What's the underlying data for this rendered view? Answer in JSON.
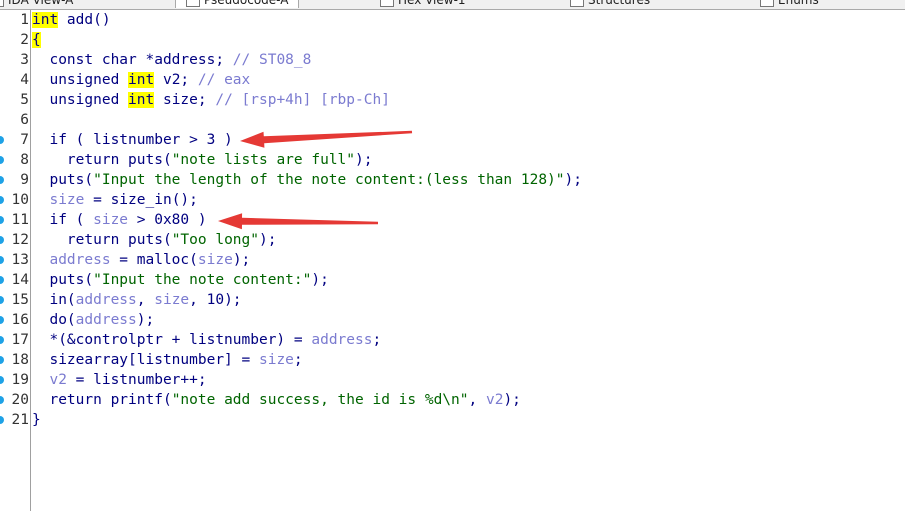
{
  "tabs": [
    {
      "label": "IDA View-A",
      "icon": "ida-view-icon"
    },
    {
      "label": "Pseudocode-A",
      "icon": "pseudocode-icon",
      "active": true
    },
    {
      "label": "Hex View-1",
      "icon": "hex-view-icon"
    },
    {
      "label": "Structures",
      "icon": "structures-icon"
    },
    {
      "label": "Enums",
      "icon": "enums-icon"
    }
  ],
  "colors": {
    "keyword": "#000080",
    "variable": "#7b7bd0",
    "string": "#006400",
    "highlight": "#ffff00",
    "breakpoint": "#1fa2e6",
    "arrow": "#e53935"
  },
  "lines": [
    {
      "n": "1",
      "bp": false,
      "tokens": [
        [
          "hl",
          "int"
        ],
        [
          "kw",
          " add()"
        ]
      ]
    },
    {
      "n": "2",
      "bp": false,
      "tokens": [
        [
          "hl",
          "{"
        ]
      ]
    },
    {
      "n": "3",
      "bp": false,
      "tokens": [
        [
          "kw",
          "  const char *address; "
        ],
        [
          "cmt",
          "// ST08_8"
        ]
      ]
    },
    {
      "n": "4",
      "bp": false,
      "tokens": [
        [
          "kw",
          "  unsigned "
        ],
        [
          "hl",
          "int"
        ],
        [
          "kw",
          " v2; "
        ],
        [
          "cmt",
          "// eax"
        ]
      ]
    },
    {
      "n": "5",
      "bp": false,
      "tokens": [
        [
          "kw",
          "  unsigned "
        ],
        [
          "hl",
          "int"
        ],
        [
          "kw",
          " size; "
        ],
        [
          "cmt",
          "// [rsp+4h] [rbp-Ch]"
        ]
      ]
    },
    {
      "n": "6",
      "bp": false,
      "tokens": []
    },
    {
      "n": "7",
      "bp": true,
      "tokens": [
        [
          "kw",
          "  if ( listnumber > 3 )"
        ]
      ]
    },
    {
      "n": "8",
      "bp": true,
      "tokens": [
        [
          "kw",
          "    return puts("
        ],
        [
          "str",
          "\"note lists are full\""
        ],
        [
          "kw",
          ");"
        ]
      ]
    },
    {
      "n": "9",
      "bp": true,
      "tokens": [
        [
          "kw",
          "  puts("
        ],
        [
          "str",
          "\"Input the length of the note content:(less than 128)\""
        ],
        [
          "kw",
          ");"
        ]
      ]
    },
    {
      "n": "10",
      "bp": true,
      "tokens": [
        [
          "var",
          "  size"
        ],
        [
          "kw",
          " = size_in();"
        ]
      ]
    },
    {
      "n": "11",
      "bp": true,
      "tokens": [
        [
          "kw",
          "  if ( "
        ],
        [
          "var",
          "size"
        ],
        [
          "kw",
          " > 0x80 )"
        ]
      ]
    },
    {
      "n": "12",
      "bp": true,
      "tokens": [
        [
          "kw",
          "    return puts("
        ],
        [
          "str",
          "\"Too long\""
        ],
        [
          "kw",
          ");"
        ]
      ]
    },
    {
      "n": "13",
      "bp": true,
      "tokens": [
        [
          "var",
          "  address"
        ],
        [
          "kw",
          " = malloc("
        ],
        [
          "var",
          "size"
        ],
        [
          "kw",
          ");"
        ]
      ]
    },
    {
      "n": "14",
      "bp": true,
      "tokens": [
        [
          "kw",
          "  puts("
        ],
        [
          "str",
          "\"Input the note content:\""
        ],
        [
          "kw",
          ");"
        ]
      ]
    },
    {
      "n": "15",
      "bp": true,
      "tokens": [
        [
          "kw",
          "  in("
        ],
        [
          "var",
          "address"
        ],
        [
          "kw",
          ", "
        ],
        [
          "var",
          "size"
        ],
        [
          "kw",
          ", 10);"
        ]
      ]
    },
    {
      "n": "16",
      "bp": true,
      "tokens": [
        [
          "kw",
          "  do("
        ],
        [
          "var",
          "address"
        ],
        [
          "kw",
          ");"
        ]
      ]
    },
    {
      "n": "17",
      "bp": true,
      "tokens": [
        [
          "kw",
          "  *(&controlptr + listnumber) = "
        ],
        [
          "var",
          "address"
        ],
        [
          "kw",
          ";"
        ]
      ]
    },
    {
      "n": "18",
      "bp": true,
      "tokens": [
        [
          "kw",
          "  sizearray[listnumber] = "
        ],
        [
          "var",
          "size"
        ],
        [
          "kw",
          ";"
        ]
      ]
    },
    {
      "n": "19",
      "bp": true,
      "tokens": [
        [
          "var",
          "  v2"
        ],
        [
          "kw",
          " = listnumber++;"
        ]
      ]
    },
    {
      "n": "20",
      "bp": true,
      "tokens": [
        [
          "kw",
          "  return printf("
        ],
        [
          "str",
          "\"note add success, the id is %d\\n\""
        ],
        [
          "kw",
          ", "
        ],
        [
          "var",
          "v2"
        ],
        [
          "kw",
          ");"
        ]
      ]
    },
    {
      "n": "21",
      "bp": true,
      "tokens": [
        [
          "kw",
          "}"
        ]
      ]
    }
  ],
  "annotations": [
    {
      "name": "red-arrow-listnumber",
      "line": 7
    },
    {
      "name": "red-arrow-size-check",
      "line": 11
    }
  ]
}
